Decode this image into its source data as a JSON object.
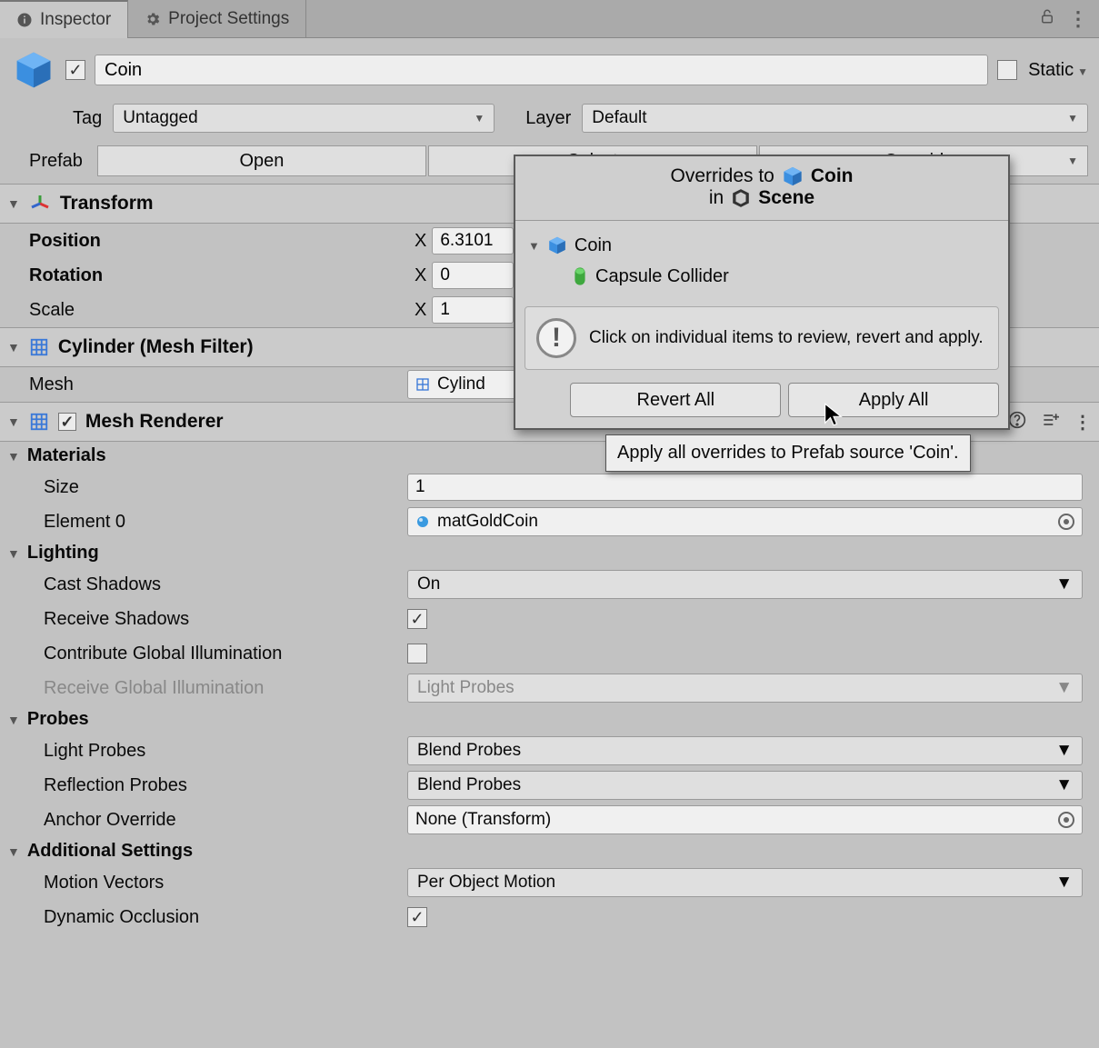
{
  "tabs": {
    "inspector": "Inspector",
    "project_settings": "Project Settings"
  },
  "header": {
    "name": "Coin",
    "enabled": true,
    "static_label": "Static",
    "static_checked": false,
    "tag_label": "Tag",
    "tag_value": "Untagged",
    "layer_label": "Layer",
    "layer_value": "Default",
    "prefab_label": "Prefab",
    "prefab_open": "Open",
    "prefab_select": "Select",
    "prefab_overrides": "Overrides"
  },
  "transform": {
    "title": "Transform",
    "position_label": "Position",
    "rotation_label": "Rotation",
    "scale_label": "Scale",
    "position": {
      "x": "6.3101"
    },
    "rotation": {
      "x": "0"
    },
    "scale": {
      "x": "1"
    }
  },
  "mesh_filter": {
    "title": "Cylinder (Mesh Filter)",
    "mesh_label": "Mesh",
    "mesh_value": "Cylind"
  },
  "mesh_renderer": {
    "title": "Mesh Renderer",
    "enabled": true,
    "materials": {
      "title": "Materials",
      "size_label": "Size",
      "size_value": "1",
      "element0_label": "Element 0",
      "element0_value": "matGoldCoin"
    },
    "lighting": {
      "title": "Lighting",
      "cast_shadows_label": "Cast Shadows",
      "cast_shadows_value": "On",
      "receive_shadows_label": "Receive Shadows",
      "receive_shadows_checked": true,
      "contribute_gi_label": "Contribute Global Illumination",
      "contribute_gi_checked": false,
      "receive_gi_label": "Receive Global Illumination",
      "receive_gi_value": "Light Probes"
    },
    "probes": {
      "title": "Probes",
      "light_probes_label": "Light Probes",
      "light_probes_value": "Blend Probes",
      "reflection_probes_label": "Reflection Probes",
      "reflection_probes_value": "Blend Probes",
      "anchor_override_label": "Anchor Override",
      "anchor_override_value": "None (Transform)"
    },
    "additional": {
      "title": "Additional Settings",
      "motion_vectors_label": "Motion Vectors",
      "motion_vectors_value": "Per Object Motion",
      "dynamic_occlusion_label": "Dynamic Occlusion",
      "dynamic_occlusion_checked": true
    }
  },
  "popup": {
    "overrides_to": "Overrides to",
    "target_name": "Coin",
    "in_label": "in",
    "in_value": "Scene",
    "tree_root": "Coin",
    "tree_child": "Capsule Collider",
    "info": "Click on individual items to review, revert and apply.",
    "revert_all": "Revert All",
    "apply_all": "Apply All"
  },
  "tooltip": "Apply all overrides to Prefab source 'Coin'."
}
